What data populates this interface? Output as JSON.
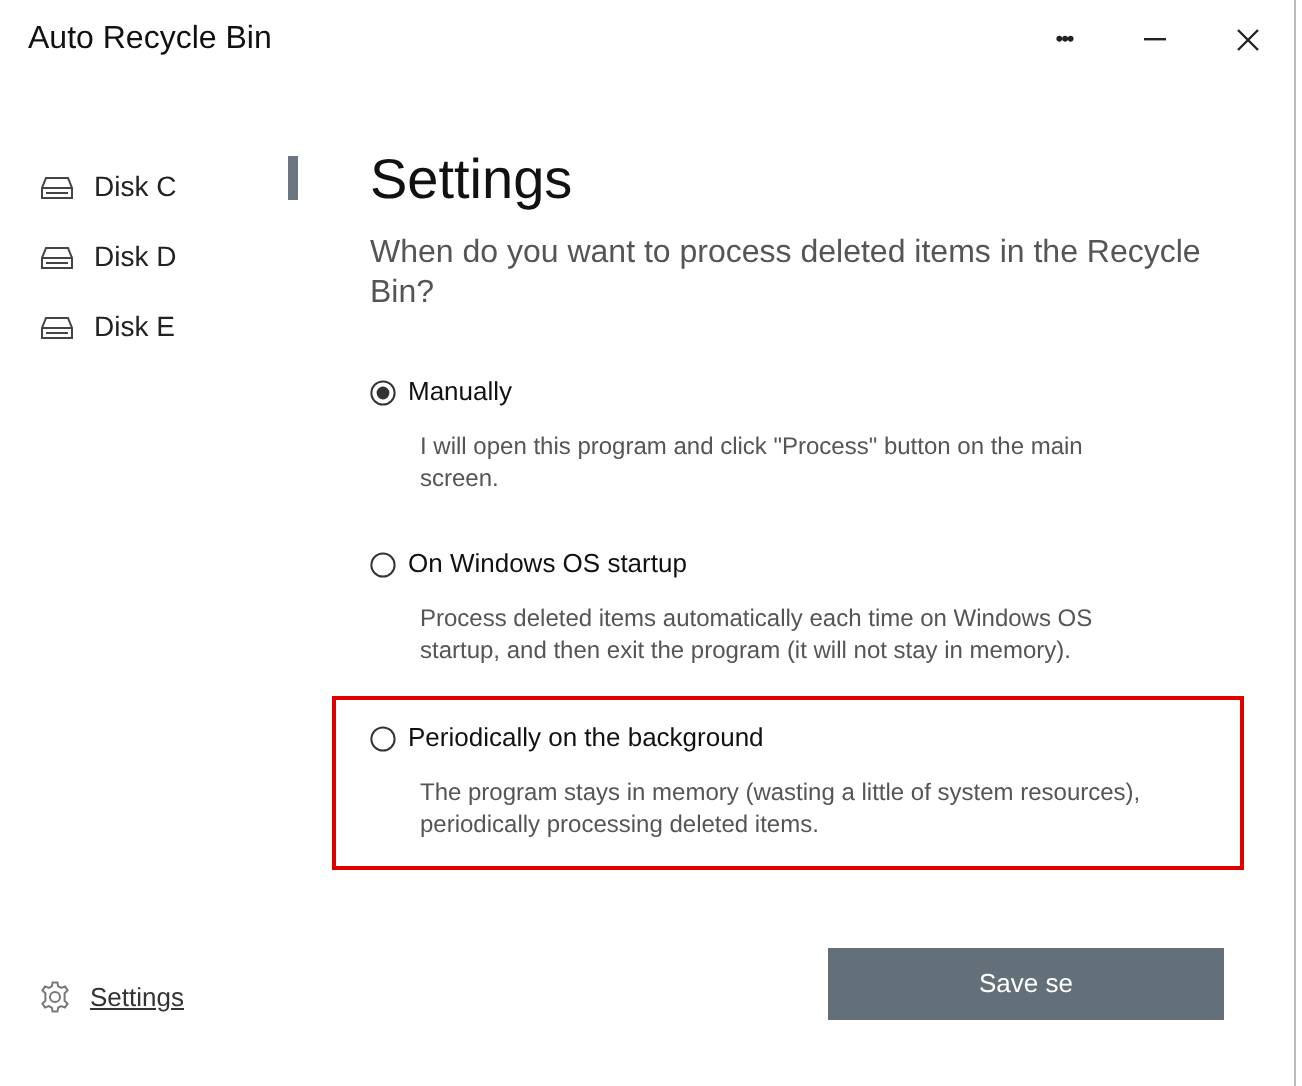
{
  "window": {
    "title": "Auto Recycle Bin",
    "controls": [
      "•••"
    ]
  },
  "sidebar": {
    "items": [
      {
        "label": "Disk C"
      },
      {
        "label": "Disk D"
      },
      {
        "label": "Disk E"
      }
    ],
    "footer_link": "Settings"
  },
  "content": {
    "heading": "Settings",
    "question": "When do you want to process deleted items in the Recycle Bin?",
    "options": [
      {
        "label": "Manually",
        "description": "I will open this program and click \"Process\" button on the main screen.",
        "selected": true,
        "highlighted": false
      },
      {
        "label": "On Windows OS startup",
        "description": "Process deleted items automatically each time on Windows OS startup, and then exit the program (it will not stay in memory).",
        "selected": false,
        "highlighted": false
      },
      {
        "label": "Periodically on the background",
        "description": "The program stays in memory (wasting a little of system resources), periodically processing deleted items.",
        "selected": false,
        "highlighted": true
      }
    ],
    "save_button": "Save se"
  }
}
